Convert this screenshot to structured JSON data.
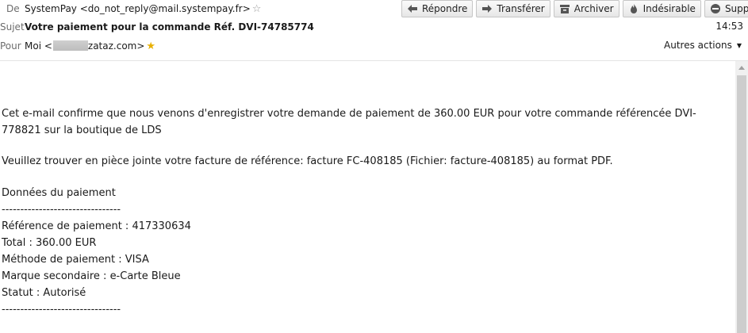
{
  "header": {
    "from_label": "De",
    "from_value": "SystemPay <do_not_reply@mail.systempay.fr>",
    "subject_label": "Sujet",
    "subject_value": "Votre paiement pour la commande Réf. DVI-74785774",
    "to_label": "Pour",
    "to_prefix": "Moi <",
    "to_suffix": "zataz.com>",
    "time": "14:53",
    "other_actions": "Autres actions"
  },
  "toolbar": {
    "reply": "Répondre",
    "forward": "Transférer",
    "archive": "Archiver",
    "junk": "Indésirable",
    "delete": "Supprimer"
  },
  "icons": {
    "reply": "reply-arrow-icon",
    "forward": "forward-arrow-icon",
    "archive": "archive-box-icon",
    "junk": "junk-flame-icon",
    "delete": "delete-no-icon",
    "star": "star-icon"
  },
  "colors": {
    "star_favorite": "#e8b000",
    "label_gray": "#6d6d6d"
  },
  "message": {
    "paragraph_1": "Cet e-mail confirme que nous venons d'enregistrer votre demande de paiement de 360.00 EUR pour votre commande référencée DVI-778821 sur la boutique de LDS",
    "paragraph_2": "Veuillez trouver en pièce jointe votre facture de référence: facture FC-408185 (Fichier: facture-408185) au format PDF.",
    "section_title": "Données du paiement",
    "divider": "--------------------------------",
    "reference": "Référence de paiement : 417330634",
    "total": "Total : 360.00 EUR",
    "method": "Méthode de paiement : VISA",
    "brand": "Marque secondaire : e-Carte Bleue",
    "status": "Statut : Autorisé",
    "divider_2": "--------------------------------"
  }
}
